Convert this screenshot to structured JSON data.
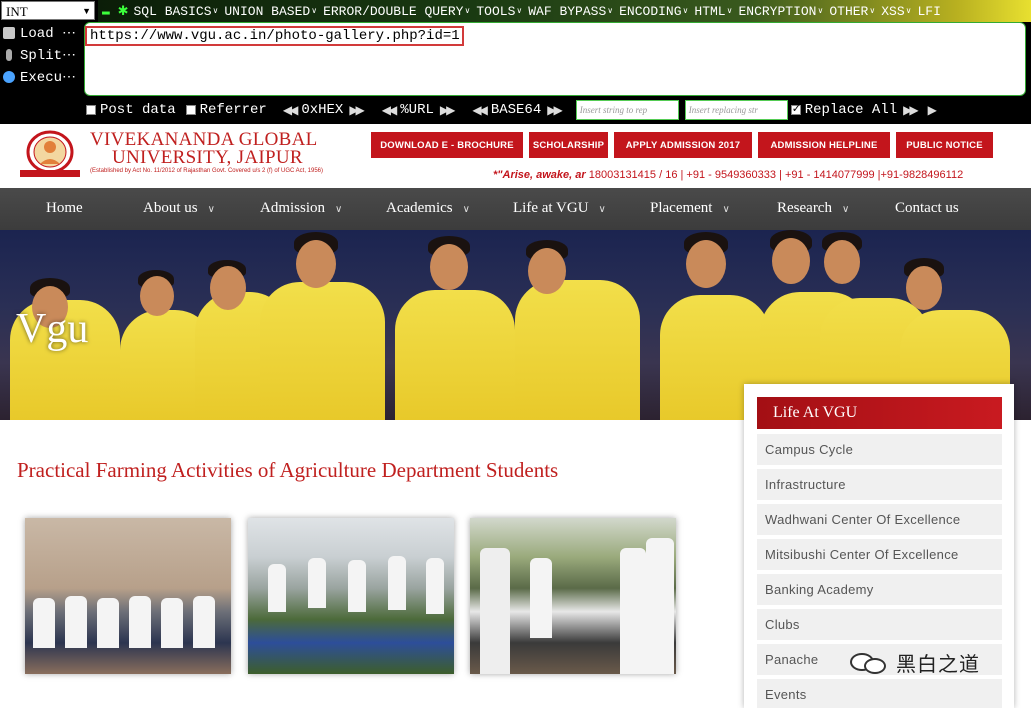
{
  "hackbar": {
    "select_value": "INT",
    "menu": [
      "SQL BASICS",
      "UNION BASED",
      "ERROR/DOUBLE QUERY",
      "TOOLS",
      "WAF BYPASS",
      "ENCODING",
      "HTML",
      "ENCRYPTION",
      "OTHER",
      "XSS",
      "LFI"
    ],
    "actions": [
      "Load ⋯",
      "Split⋯",
      "Execu⋯"
    ],
    "url": "https://www.vgu.ac.in/photo-gallery.php?id=1",
    "post_data_label": "Post data",
    "referrer_label": "Referrer",
    "hex_label": "0xHEX",
    "url_label": "%URL",
    "base64_label": "BASE64",
    "insert_placeholder": "Insert string to rep",
    "replacing_placeholder": "Insert replacing str",
    "replace_all_label": "Replace All"
  },
  "header": {
    "name_line1": "VIVEKANANDA  GLOBAL",
    "name_line2": "UNIVERSITY, JAIPUR",
    "established": "(Established by Act No. 11/2012 of Rajasthan Govt. Covered u/s 2 (f) of UGC Act, 1956)",
    "buttons": [
      "DOWNLOAD E - BROCHURE",
      "SCHOLARSHIP",
      "APPLY ADMISSION 2017",
      "ADMISSION HELPLINE",
      "PUBLIC NOTICE"
    ],
    "motto": "*\"Arise, awake, ar",
    "phones": "18003131415 / 16 | +91 - 9549360333 | +91 - 1414077999 |+91-9828496112"
  },
  "nav": [
    "Home",
    "About us",
    "Admission",
    "Academics",
    "Life at VGU",
    "Placement",
    "Research",
    "Contact us"
  ],
  "banner": {
    "title": "Vgu"
  },
  "main": {
    "title": "Practical Farming Activities of Agriculture Department Students"
  },
  "sidebar": {
    "title": "Life At VGU",
    "items": [
      "Campus Cycle",
      "Infrastructure",
      "Wadhwani Center Of Excellence",
      "Mitsibushi Center Of Excellence",
      "Banking Academy",
      "Clubs",
      "Panache",
      "Events"
    ]
  },
  "watermark": "黑白之道",
  "colors": {
    "brand_red": "#c3151c",
    "nav_bg": "#444444",
    "hackbar_bg": "#000000"
  }
}
